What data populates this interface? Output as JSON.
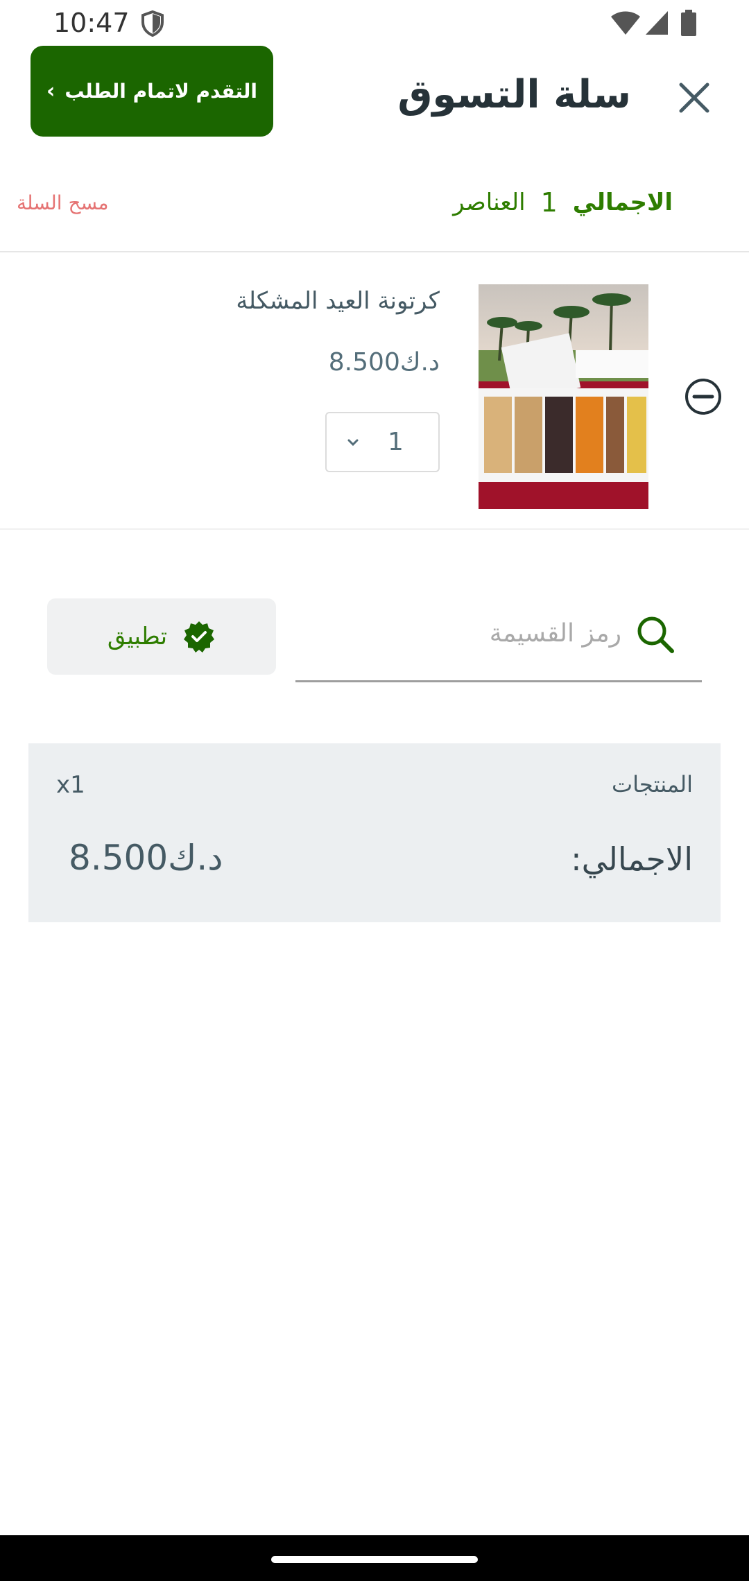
{
  "status_bar": {
    "time": "10:47"
  },
  "header": {
    "title": "سلة التسوق",
    "checkout_label": "التقدم لاتمام الطلب"
  },
  "summary": {
    "total_label": "الاجمالي",
    "item_count": "1",
    "items_label": "العناصر",
    "clear_cart_label": "مسح السلة"
  },
  "cart_items": [
    {
      "name": "كرتونة العيد المشكلة",
      "price": "8.500د.ك",
      "quantity": "1"
    }
  ],
  "coupon": {
    "placeholder": "رمز القسيمة",
    "apply_label": "تطبيق"
  },
  "totals": {
    "products_label": "المنتجات",
    "products_count": "x1",
    "grand_total_label": "الاجمالي:",
    "grand_total_value": "8.500د.ك"
  },
  "colors": {
    "brand_green": "#1b6600",
    "accent_green": "#2e7d00",
    "clear_red": "#e57373",
    "panel_gray": "#eceff1"
  }
}
